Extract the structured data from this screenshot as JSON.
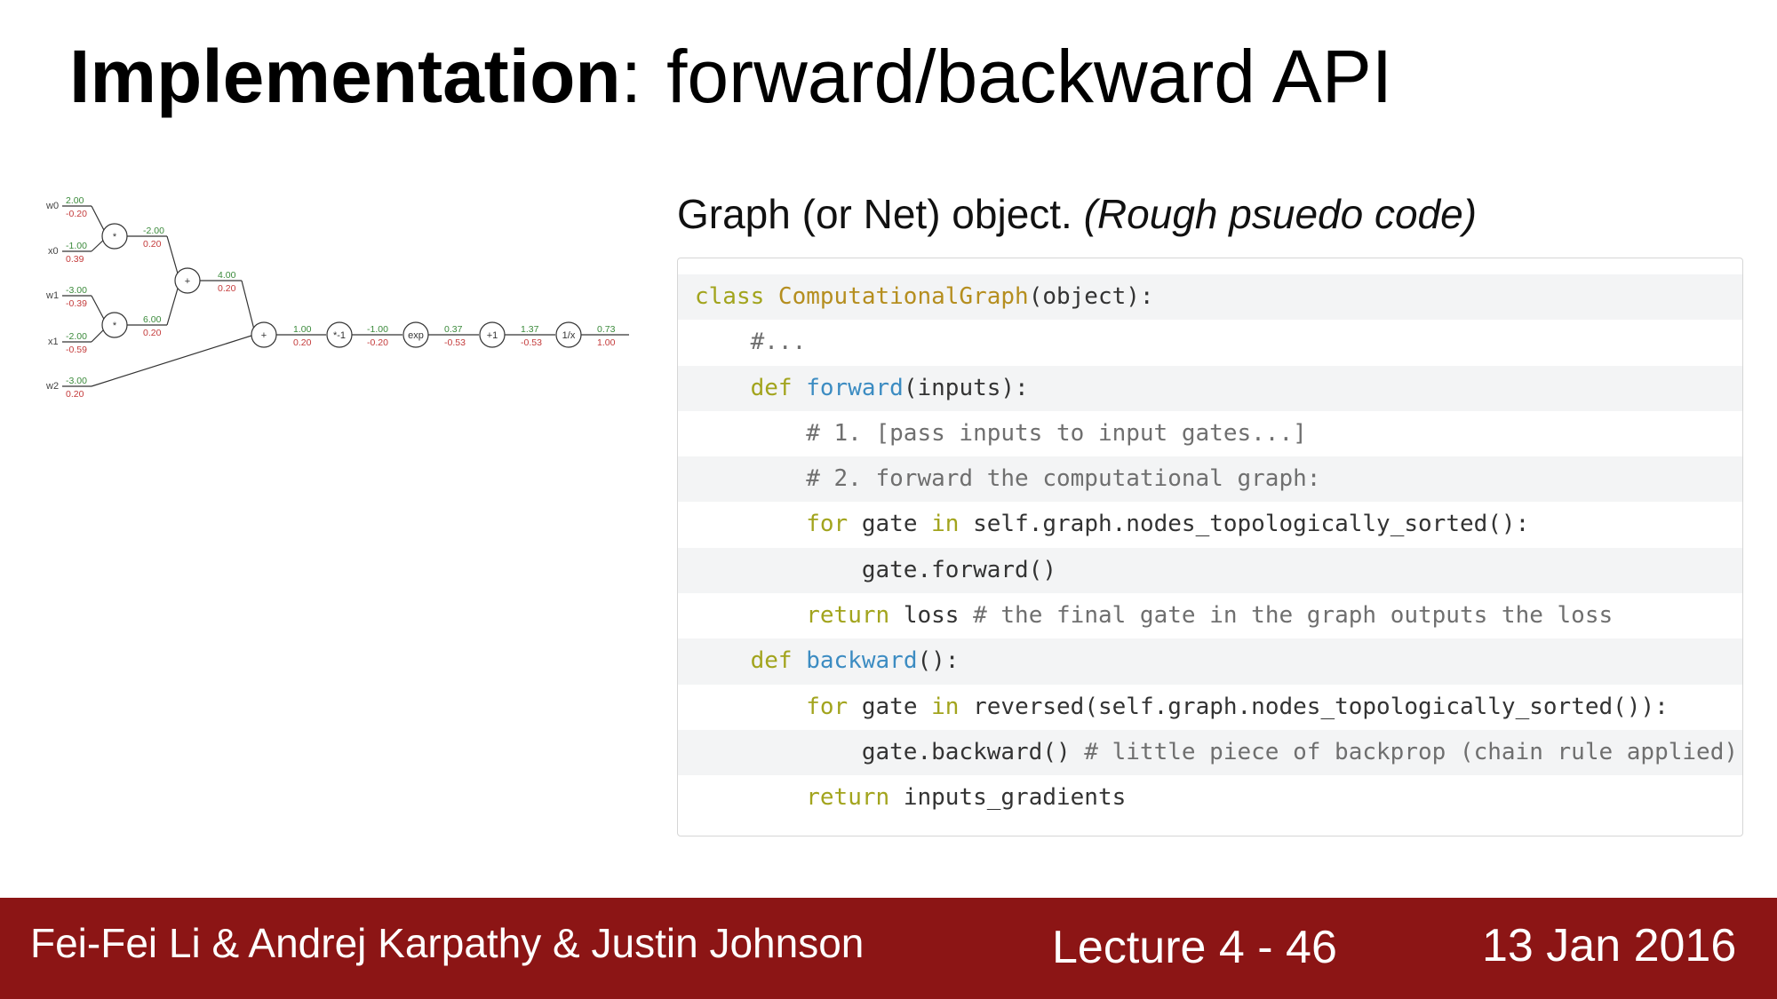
{
  "title": {
    "bold": "Implementation",
    "sep": ":",
    "rest": "forward/backward API"
  },
  "graph": {
    "inputs": [
      {
        "name": "w0",
        "value": "2.00",
        "grad": "-0.20"
      },
      {
        "name": "x0",
        "value": "-1.00",
        "grad": "0.39"
      },
      {
        "name": "w1",
        "value": "-3.00",
        "grad": "-0.39"
      },
      {
        "name": "x1",
        "value": "-2.00",
        "grad": "-0.59"
      },
      {
        "name": "w2",
        "value": "-3.00",
        "grad": "0.20"
      }
    ],
    "nodes": [
      "*",
      "*",
      "+",
      "+",
      "*-1",
      "exp",
      "+1",
      "1/x"
    ],
    "edge_values": [
      {
        "value": "-2.00",
        "grad": "0.20"
      },
      {
        "value": "6.00",
        "grad": "0.20"
      },
      {
        "value": "4.00",
        "grad": "0.20"
      },
      {
        "value": "1.00",
        "grad": "0.20"
      },
      {
        "value": "-1.00",
        "grad": "-0.20"
      },
      {
        "value": "0.37",
        "grad": "-0.53"
      },
      {
        "value": "1.37",
        "grad": "-0.53"
      },
      {
        "value": "0.73",
        "grad": "1.00"
      }
    ],
    "colors": {
      "value": "#3b8a3b",
      "grad": "#c43b3b",
      "line": "#333333"
    }
  },
  "code": {
    "caption": "Graph (or Net) object. ",
    "caption_italic": "(Rough psuedo code)",
    "lines": [
      [
        {
          "t": "class ",
          "c": "kw"
        },
        {
          "t": "ComputationalGraph",
          "c": "cls"
        },
        {
          "t": "(object):",
          "c": "tx"
        }
      ],
      [
        {
          "t": "    #...",
          "c": "cm"
        }
      ],
      [
        {
          "t": "    ",
          "c": "tx"
        },
        {
          "t": "def ",
          "c": "kw"
        },
        {
          "t": "forward",
          "c": "fn"
        },
        {
          "t": "(inputs):",
          "c": "tx"
        }
      ],
      [
        {
          "t": "        # 1. [pass inputs to input gates...]",
          "c": "cm"
        }
      ],
      [
        {
          "t": "        # 2. forward the computational graph:",
          "c": "cm"
        }
      ],
      [
        {
          "t": "        ",
          "c": "tx"
        },
        {
          "t": "for ",
          "c": "kw"
        },
        {
          "t": "gate ",
          "c": "tx"
        },
        {
          "t": "in ",
          "c": "kw"
        },
        {
          "t": "self.graph.nodes_topologically_sorted():",
          "c": "tx"
        }
      ],
      [
        {
          "t": "            gate.forward()",
          "c": "tx"
        }
      ],
      [
        {
          "t": "        ",
          "c": "tx"
        },
        {
          "t": "return ",
          "c": "kw"
        },
        {
          "t": "loss ",
          "c": "tx"
        },
        {
          "t": "# the final gate in the graph outputs the loss",
          "c": "cm"
        }
      ],
      [
        {
          "t": "    ",
          "c": "tx"
        },
        {
          "t": "def ",
          "c": "kw"
        },
        {
          "t": "backward",
          "c": "fn"
        },
        {
          "t": "():",
          "c": "tx"
        }
      ],
      [
        {
          "t": "        ",
          "c": "tx"
        },
        {
          "t": "for ",
          "c": "kw"
        },
        {
          "t": "gate ",
          "c": "tx"
        },
        {
          "t": "in ",
          "c": "kw"
        },
        {
          "t": "reversed(self.graph.nodes_topologically_sorted()):",
          "c": "tx"
        }
      ],
      [
        {
          "t": "            gate.backward() ",
          "c": "tx"
        },
        {
          "t": "# little piece of backprop (chain rule applied)",
          "c": "cm"
        }
      ],
      [
        {
          "t": "        ",
          "c": "tx"
        },
        {
          "t": "return ",
          "c": "kw"
        },
        {
          "t": "inputs_gradients",
          "c": "tx"
        }
      ]
    ]
  },
  "footer": {
    "authors": "Fei-Fei Li & Andrej Karpathy & Justin Johnson",
    "lecture": "Lecture 4 - 46",
    "date": "13 Jan 2016"
  }
}
